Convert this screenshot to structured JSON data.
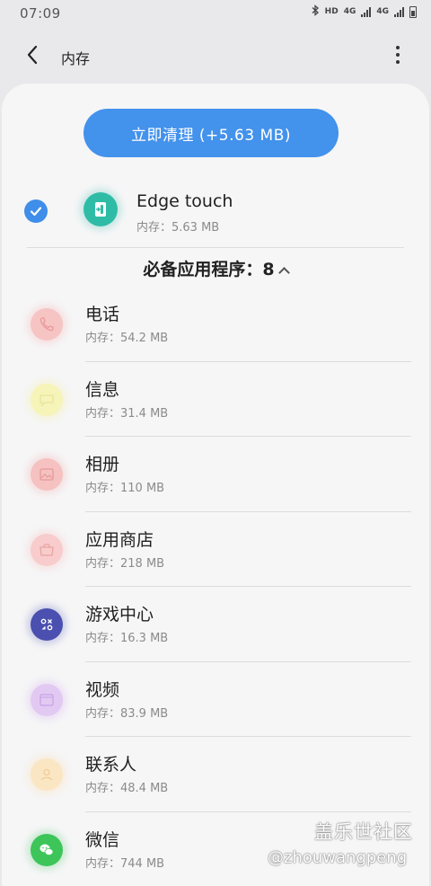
{
  "status_bar": {
    "time": "07:09",
    "indicators": [
      "bluetooth-icon",
      "HD",
      "4G",
      "4G",
      "battery-icon"
    ],
    "hd_label": "HD",
    "net1_label": "4G",
    "net2_label": "4G"
  },
  "header": {
    "title": "内存",
    "back_icon": "chevron-left-icon",
    "more_icon": "more-vertical-icon"
  },
  "clean_button": {
    "label": "立即清理 (+5.63 MB)",
    "color": "#4392ec"
  },
  "selected_app": {
    "name": "Edge touch",
    "memory": "内存：5.63 MB",
    "checked": true,
    "icon": "edge-touch-icon",
    "icon_color": "#2fbca7"
  },
  "essential_section": {
    "label": "必备应用程序：8",
    "expanded": true
  },
  "apps": [
    {
      "name": "电话",
      "memory": "内存：54.2 MB",
      "icon": "phone-icon",
      "color": "#f7c4c4"
    },
    {
      "name": "信息",
      "memory": "内存：31.4 MB",
      "icon": "message-icon",
      "color": "#f6f4b9"
    },
    {
      "name": "相册",
      "memory": "内存：110 MB",
      "icon": "gallery-icon",
      "color": "#f5c1c1"
    },
    {
      "name": "应用商店",
      "memory": "内存：218 MB",
      "icon": "store-icon",
      "color": "#f8cccc"
    },
    {
      "name": "游戏中心",
      "memory": "内存：16.3 MB",
      "icon": "game-center-icon",
      "color": "#4a4fb0"
    },
    {
      "name": "视频",
      "memory": "内存：83.9 MB",
      "icon": "video-icon",
      "color": "#e2c9f2"
    },
    {
      "name": "联系人",
      "memory": "内存：48.4 MB",
      "icon": "contacts-icon",
      "color": "#fbe6c4"
    },
    {
      "name": "微信",
      "memory": "内存：744 MB",
      "icon": "wechat-icon",
      "color": "#3dc55a"
    }
  ],
  "watermark": {
    "logo": "盖乐世社区",
    "user": "@zhouwangpeng"
  }
}
